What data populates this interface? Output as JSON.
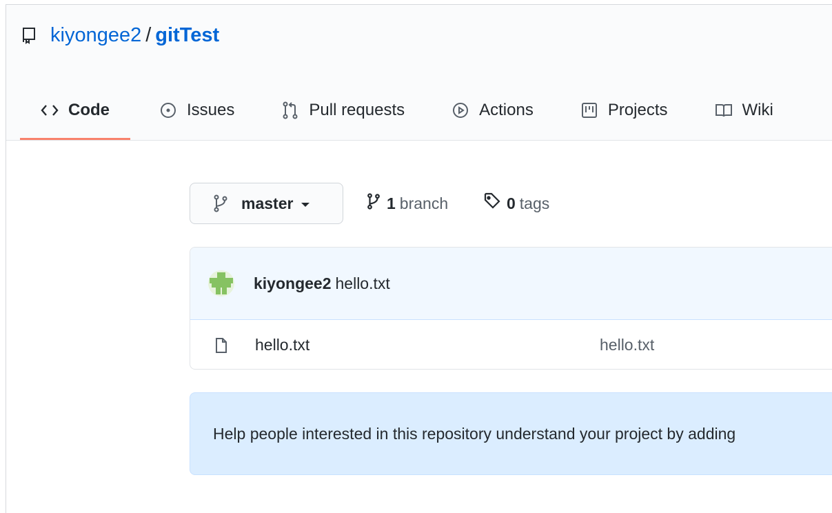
{
  "repo": {
    "owner": "kiyongee2",
    "separator": "/",
    "name": "gitTest"
  },
  "tabs": [
    {
      "label": "Code",
      "icon": "code-icon",
      "selected": true
    },
    {
      "label": "Issues",
      "icon": "issue-icon"
    },
    {
      "label": "Pull requests",
      "icon": "pull-request-icon"
    },
    {
      "label": "Actions",
      "icon": "play-icon"
    },
    {
      "label": "Projects",
      "icon": "project-icon"
    },
    {
      "label": "Wiki",
      "icon": "book-icon"
    }
  ],
  "branch_selector": {
    "label": "master"
  },
  "branch_count": {
    "count": "1",
    "label": "branch"
  },
  "tag_count": {
    "count": "0",
    "label": "tags"
  },
  "latest_commit": {
    "author": "kiyongee2",
    "message": "hello.txt"
  },
  "files": [
    {
      "name": "hello.txt",
      "commit_message": "hello.txt"
    }
  ],
  "about_prompt": "Help people interested in this repository understand your project by adding",
  "colors": {
    "link": "#0366d6",
    "selected_tab_underline": "#f9826c",
    "commit_row_bg": "#f1f8ff",
    "about_bg": "#dbedff"
  }
}
